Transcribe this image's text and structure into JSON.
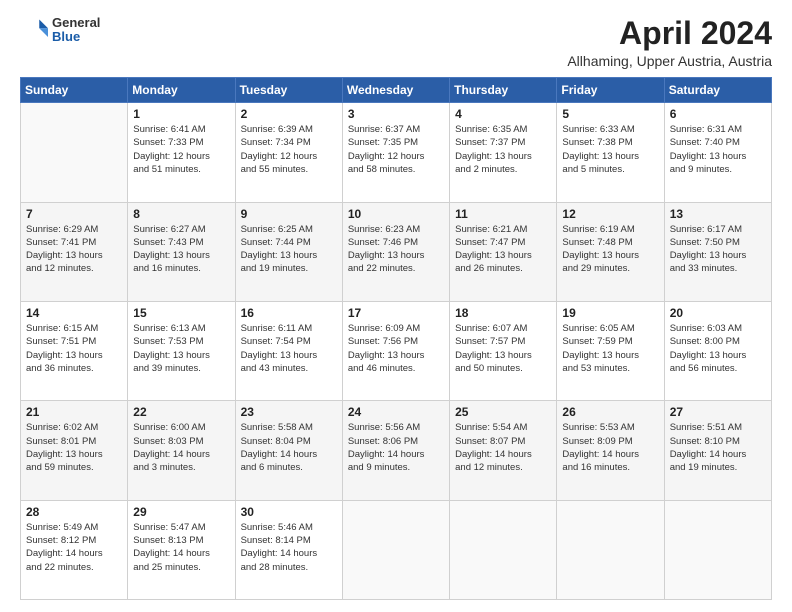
{
  "header": {
    "logo_general": "General",
    "logo_blue": "Blue",
    "month_title": "April 2024",
    "location": "Allhaming, Upper Austria, Austria"
  },
  "weekdays": [
    "Sunday",
    "Monday",
    "Tuesday",
    "Wednesday",
    "Thursday",
    "Friday",
    "Saturday"
  ],
  "weeks": [
    [
      {
        "day": "",
        "detail": ""
      },
      {
        "day": "1",
        "detail": "Sunrise: 6:41 AM\nSunset: 7:33 PM\nDaylight: 12 hours\nand 51 minutes."
      },
      {
        "day": "2",
        "detail": "Sunrise: 6:39 AM\nSunset: 7:34 PM\nDaylight: 12 hours\nand 55 minutes."
      },
      {
        "day": "3",
        "detail": "Sunrise: 6:37 AM\nSunset: 7:35 PM\nDaylight: 12 hours\nand 58 minutes."
      },
      {
        "day": "4",
        "detail": "Sunrise: 6:35 AM\nSunset: 7:37 PM\nDaylight: 13 hours\nand 2 minutes."
      },
      {
        "day": "5",
        "detail": "Sunrise: 6:33 AM\nSunset: 7:38 PM\nDaylight: 13 hours\nand 5 minutes."
      },
      {
        "day": "6",
        "detail": "Sunrise: 6:31 AM\nSunset: 7:40 PM\nDaylight: 13 hours\nand 9 minutes."
      }
    ],
    [
      {
        "day": "7",
        "detail": "Sunrise: 6:29 AM\nSunset: 7:41 PM\nDaylight: 13 hours\nand 12 minutes."
      },
      {
        "day": "8",
        "detail": "Sunrise: 6:27 AM\nSunset: 7:43 PM\nDaylight: 13 hours\nand 16 minutes."
      },
      {
        "day": "9",
        "detail": "Sunrise: 6:25 AM\nSunset: 7:44 PM\nDaylight: 13 hours\nand 19 minutes."
      },
      {
        "day": "10",
        "detail": "Sunrise: 6:23 AM\nSunset: 7:46 PM\nDaylight: 13 hours\nand 22 minutes."
      },
      {
        "day": "11",
        "detail": "Sunrise: 6:21 AM\nSunset: 7:47 PM\nDaylight: 13 hours\nand 26 minutes."
      },
      {
        "day": "12",
        "detail": "Sunrise: 6:19 AM\nSunset: 7:48 PM\nDaylight: 13 hours\nand 29 minutes."
      },
      {
        "day": "13",
        "detail": "Sunrise: 6:17 AM\nSunset: 7:50 PM\nDaylight: 13 hours\nand 33 minutes."
      }
    ],
    [
      {
        "day": "14",
        "detail": "Sunrise: 6:15 AM\nSunset: 7:51 PM\nDaylight: 13 hours\nand 36 minutes."
      },
      {
        "day": "15",
        "detail": "Sunrise: 6:13 AM\nSunset: 7:53 PM\nDaylight: 13 hours\nand 39 minutes."
      },
      {
        "day": "16",
        "detail": "Sunrise: 6:11 AM\nSunset: 7:54 PM\nDaylight: 13 hours\nand 43 minutes."
      },
      {
        "day": "17",
        "detail": "Sunrise: 6:09 AM\nSunset: 7:56 PM\nDaylight: 13 hours\nand 46 minutes."
      },
      {
        "day": "18",
        "detail": "Sunrise: 6:07 AM\nSunset: 7:57 PM\nDaylight: 13 hours\nand 50 minutes."
      },
      {
        "day": "19",
        "detail": "Sunrise: 6:05 AM\nSunset: 7:59 PM\nDaylight: 13 hours\nand 53 minutes."
      },
      {
        "day": "20",
        "detail": "Sunrise: 6:03 AM\nSunset: 8:00 PM\nDaylight: 13 hours\nand 56 minutes."
      }
    ],
    [
      {
        "day": "21",
        "detail": "Sunrise: 6:02 AM\nSunset: 8:01 PM\nDaylight: 13 hours\nand 59 minutes."
      },
      {
        "day": "22",
        "detail": "Sunrise: 6:00 AM\nSunset: 8:03 PM\nDaylight: 14 hours\nand 3 minutes."
      },
      {
        "day": "23",
        "detail": "Sunrise: 5:58 AM\nSunset: 8:04 PM\nDaylight: 14 hours\nand 6 minutes."
      },
      {
        "day": "24",
        "detail": "Sunrise: 5:56 AM\nSunset: 8:06 PM\nDaylight: 14 hours\nand 9 minutes."
      },
      {
        "day": "25",
        "detail": "Sunrise: 5:54 AM\nSunset: 8:07 PM\nDaylight: 14 hours\nand 12 minutes."
      },
      {
        "day": "26",
        "detail": "Sunrise: 5:53 AM\nSunset: 8:09 PM\nDaylight: 14 hours\nand 16 minutes."
      },
      {
        "day": "27",
        "detail": "Sunrise: 5:51 AM\nSunset: 8:10 PM\nDaylight: 14 hours\nand 19 minutes."
      }
    ],
    [
      {
        "day": "28",
        "detail": "Sunrise: 5:49 AM\nSunset: 8:12 PM\nDaylight: 14 hours\nand 22 minutes."
      },
      {
        "day": "29",
        "detail": "Sunrise: 5:47 AM\nSunset: 8:13 PM\nDaylight: 14 hours\nand 25 minutes."
      },
      {
        "day": "30",
        "detail": "Sunrise: 5:46 AM\nSunset: 8:14 PM\nDaylight: 14 hours\nand 28 minutes."
      },
      {
        "day": "",
        "detail": ""
      },
      {
        "day": "",
        "detail": ""
      },
      {
        "day": "",
        "detail": ""
      },
      {
        "day": "",
        "detail": ""
      }
    ]
  ]
}
